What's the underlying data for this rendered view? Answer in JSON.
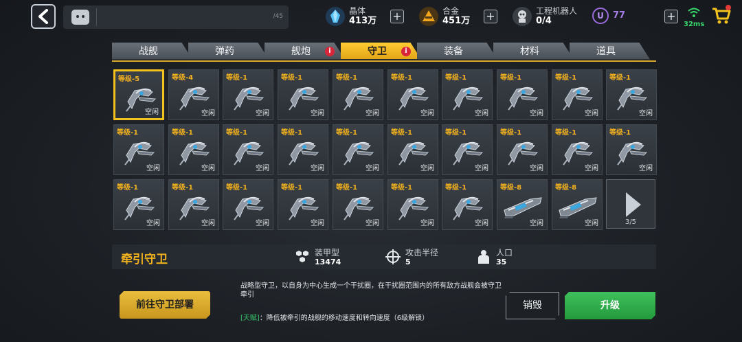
{
  "topbar": {
    "chat_count": "/45",
    "resources": [
      {
        "icon": "crystal-icon",
        "label": "晶体",
        "value": "413万",
        "color": "#4fb6f0"
      },
      {
        "icon": "alloy-icon",
        "label": "合金",
        "value": "451万",
        "color": "#f2a51e"
      },
      {
        "icon": "robot-icon",
        "label": "工程机器人",
        "value": "0/4",
        "color": "#d7dbe0"
      }
    ],
    "u_currency": {
      "icon": "u-coin-icon",
      "symbol": "U",
      "value": "77",
      "color": "#a67fe6"
    },
    "ping": "32ms"
  },
  "tabs": [
    {
      "label": "战舰",
      "active": false,
      "alert": false
    },
    {
      "label": "弹药",
      "active": false,
      "alert": false
    },
    {
      "label": "舰炮",
      "active": false,
      "alert": true
    },
    {
      "label": "守卫",
      "active": true,
      "alert": true
    },
    {
      "label": "装备",
      "active": false,
      "alert": false
    },
    {
      "label": "材料",
      "active": false,
      "alert": false
    },
    {
      "label": "道具",
      "active": false,
      "alert": false
    }
  ],
  "alert_symbol": "i",
  "grid": {
    "items": [
      {
        "level": "等级-5",
        "status": "空闲",
        "type": "guard",
        "selected": true
      },
      {
        "level": "等级-4",
        "status": "空闲",
        "type": "guard"
      },
      {
        "level": "等级-1",
        "status": "空闲",
        "type": "guard"
      },
      {
        "level": "等级-1",
        "status": "空闲",
        "type": "guard"
      },
      {
        "level": "等级-1",
        "status": "空闲",
        "type": "guard"
      },
      {
        "level": "等级-1",
        "status": "空闲",
        "type": "guard"
      },
      {
        "level": "等级-1",
        "status": "空闲",
        "type": "guard"
      },
      {
        "level": "等级-1",
        "status": "空闲",
        "type": "guard"
      },
      {
        "level": "等级-1",
        "status": "空闲",
        "type": "guard"
      },
      {
        "level": "等级-1",
        "status": "空闲",
        "type": "guard"
      },
      {
        "level": "等级-1",
        "status": "空闲",
        "type": "guard"
      },
      {
        "level": "等级-1",
        "status": "空闲",
        "type": "guard"
      },
      {
        "level": "等级-1",
        "status": "空闲",
        "type": "guard"
      },
      {
        "level": "等级-1",
        "status": "空闲",
        "type": "guard"
      },
      {
        "level": "等级-1",
        "status": "空闲",
        "type": "guard"
      },
      {
        "level": "等级-1",
        "status": "空闲",
        "type": "guard"
      },
      {
        "level": "等级-1",
        "status": "空闲",
        "type": "guard"
      },
      {
        "level": "等级-1",
        "status": "空闲",
        "type": "guard"
      },
      {
        "level": "等级-1",
        "status": "空闲",
        "type": "guard"
      },
      {
        "level": "等级-1",
        "status": "空闲",
        "type": "guard"
      },
      {
        "level": "等级-1",
        "status": "空闲",
        "type": "guard"
      },
      {
        "level": "等级-1",
        "status": "空闲",
        "type": "guard"
      },
      {
        "level": "等级-1",
        "status": "空闲",
        "type": "guard"
      },
      {
        "level": "等级-1",
        "status": "空闲",
        "type": "guard"
      },
      {
        "level": "等级-1",
        "status": "空闲",
        "type": "guard"
      },
      {
        "level": "等级-1",
        "status": "空闲",
        "type": "guard"
      },
      {
        "level": "等级-1",
        "status": "空闲",
        "type": "guard"
      },
      {
        "level": "等级-8",
        "status": "空闲",
        "type": "cannon"
      },
      {
        "level": "等级-8",
        "status": "空闲",
        "type": "cannon"
      }
    ],
    "page": "3/5"
  },
  "detail": {
    "name": "牵引守卫",
    "stats": [
      {
        "icon": "armor-icon",
        "label": "装甲型",
        "value": "13474"
      },
      {
        "icon": "crosshair-icon",
        "label": "攻击半径",
        "value": "5"
      },
      {
        "icon": "population-icon",
        "label": "人口",
        "value": "35"
      }
    ],
    "description": "战略型守卫，以自身为中心生成一个干扰圈，在干扰圈范围内的所有敌方战舰会被守卫牵引",
    "talent_tag": "[天赋]",
    "talent_text": "：降低被牵引的战舰的移动速度和转向速度（6级解锁）",
    "deploy_label": "前往守卫部署",
    "destroy_label": "销毁",
    "upgrade_label": "升级"
  }
}
